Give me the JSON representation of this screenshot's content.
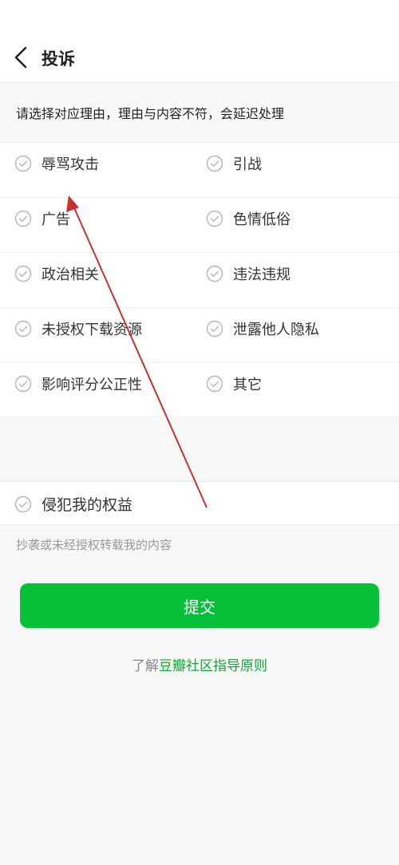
{
  "header": {
    "title": "投诉",
    "back_icon": "chevron-left-icon"
  },
  "instruction": "请选择对应理由，理由与内容不符，会延迟处理",
  "reasons": [
    {
      "left": "辱骂攻击",
      "right": "引战"
    },
    {
      "left": "广告",
      "right": "色情低俗"
    },
    {
      "left": "政治相关",
      "right": "违法违规"
    },
    {
      "left": "未授权下载资源",
      "right": "泄露他人隐私"
    },
    {
      "left": "影响评分公正性",
      "right": "其它"
    }
  ],
  "rights": {
    "label": "侵犯我的权益",
    "description": "抄袭或未经授权转载我的内容"
  },
  "submit_label": "提交",
  "guide": {
    "prefix": "了解",
    "link": "豆瓣社区指导原则"
  },
  "colors": {
    "accent": "#07c03a",
    "link": "#1aa33d",
    "annotation": "#c8312f"
  }
}
